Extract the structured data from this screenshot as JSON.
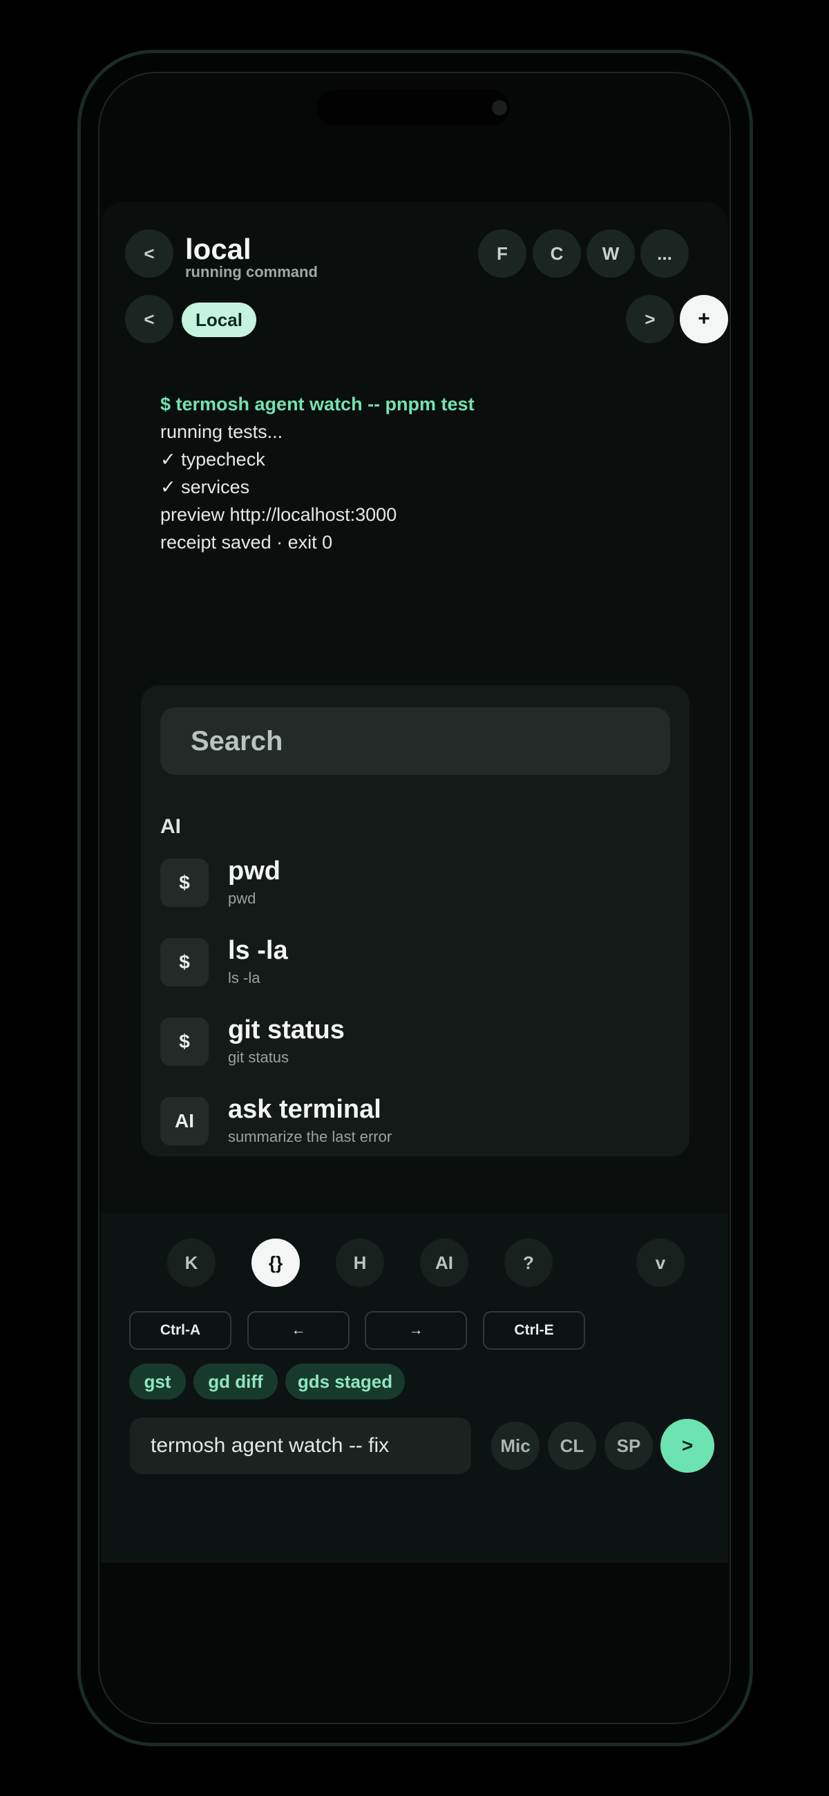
{
  "header": {
    "back_label": "<",
    "title": "local",
    "subtitle": "running command",
    "actions": [
      "F",
      "C",
      "W",
      "..."
    ]
  },
  "tabs": {
    "prev_label": "<",
    "active_tab": "Local",
    "next_label": ">",
    "add_label": "+"
  },
  "terminal": {
    "lines": [
      "$ termosh agent watch -- pnpm test",
      "running tests...",
      "✓ typecheck",
      "✓ services",
      "preview http://localhost:3000",
      "receipt saved · exit 0"
    ]
  },
  "palette": {
    "search_placeholder": "Search",
    "section_label": "AI",
    "items": [
      {
        "icon": "$",
        "title": "pwd",
        "subtitle": "pwd"
      },
      {
        "icon": "$",
        "title": "ls -la",
        "subtitle": "ls -la"
      },
      {
        "icon": "$",
        "title": "git status",
        "subtitle": "git status"
      },
      {
        "icon": "AI",
        "title": "ask terminal",
        "subtitle": "summarize the last error"
      }
    ]
  },
  "toolbar": {
    "modes": [
      "K",
      "{}",
      "H",
      "AI",
      "?"
    ],
    "active_mode": "{}",
    "collapse_label": "v",
    "keys": [
      "Ctrl-A",
      "←",
      "→",
      "Ctrl-E"
    ],
    "chips": [
      "gst",
      "gd diff",
      "gds staged"
    ],
    "input_value": "termosh agent watch -- fix",
    "actions": [
      "Mic",
      "CL",
      "SP"
    ],
    "send_label": ">"
  },
  "colors": {
    "accent": "#6de3b1",
    "tab_active": "#c5f3df",
    "command_text": "#74e2b0",
    "chip_bg": "#173a2c"
  }
}
